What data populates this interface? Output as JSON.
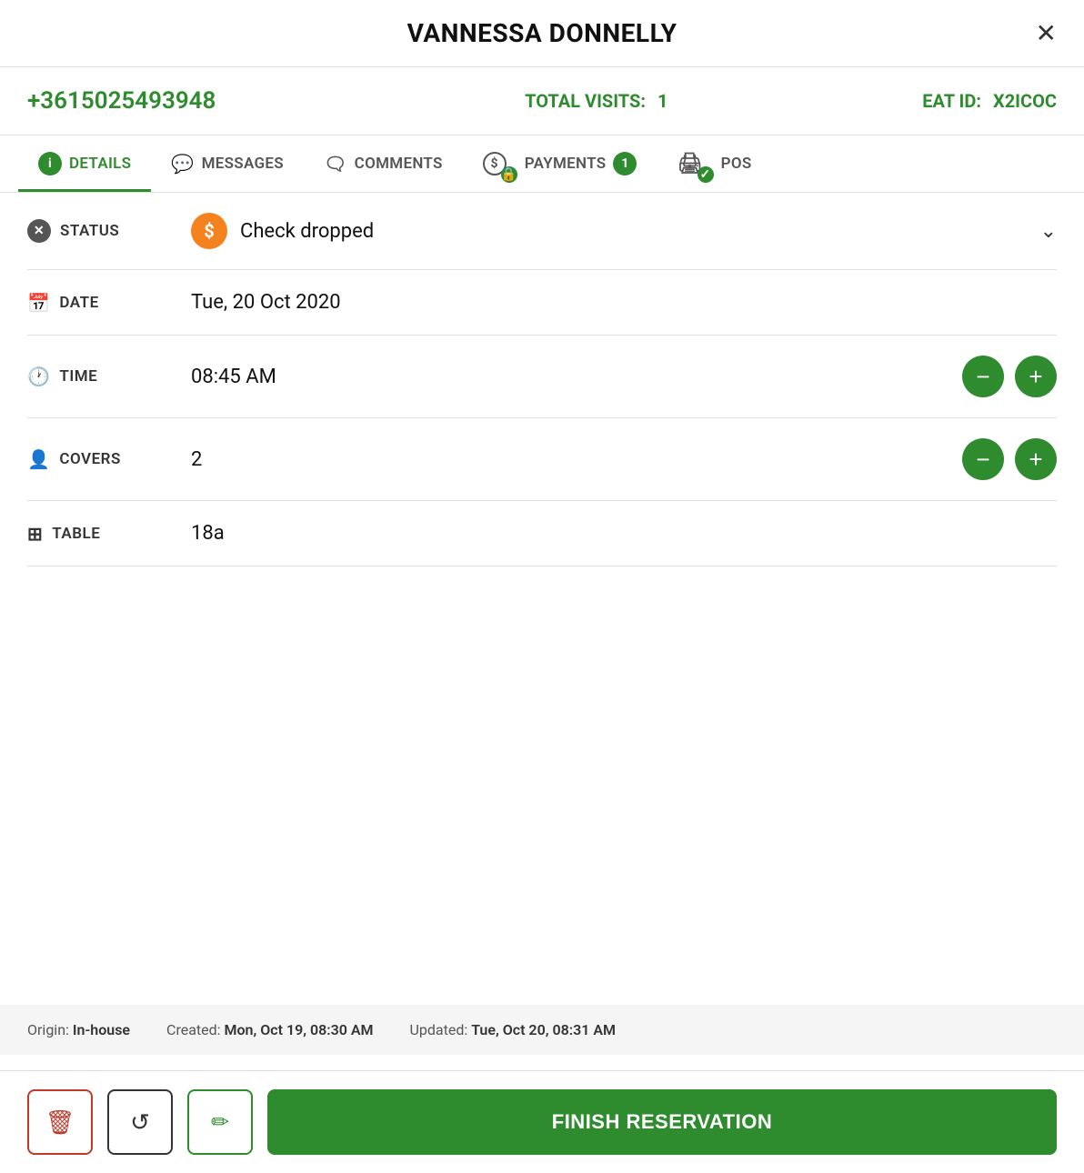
{
  "header": {
    "title": "VANNESSA DONNELLY",
    "close_label": "✕"
  },
  "info": {
    "phone": "+3615025493948",
    "total_visits_label": "TOTAL VISITS:",
    "total_visits_value": "1",
    "eat_id_label": "EAT ID:",
    "eat_id_value": "X2ICOC"
  },
  "tabs": [
    {
      "id": "details",
      "label": "DETAILS",
      "icon": "ℹ",
      "active": true,
      "badge": null
    },
    {
      "id": "messages",
      "label": "MESSAGES",
      "icon": "💬",
      "active": false,
      "badge": null
    },
    {
      "id": "comments",
      "label": "COMMENTS",
      "icon": "🗨",
      "active": false,
      "badge": null
    },
    {
      "id": "payments",
      "label": "PAYMENTS",
      "icon": "$",
      "active": false,
      "badge": "1"
    },
    {
      "id": "pos",
      "label": "POS",
      "icon": "🖨",
      "active": false,
      "badge": null
    }
  ],
  "details": {
    "status_label": "STATUS",
    "status_value": "Check dropped",
    "date_label": "DATE",
    "date_value": "Tue, 20 Oct 2020",
    "time_label": "TIME",
    "time_value": "08:45 AM",
    "covers_label": "COVERS",
    "covers_value": "2",
    "table_label": "TABLE",
    "table_value": "18a"
  },
  "footer": {
    "origin_label": "Origin:",
    "origin_value": "In-house",
    "created_label": "Created:",
    "created_value": "Mon, Oct 19, 08:30 AM",
    "updated_label": "Updated:",
    "updated_value": "Tue, Oct 20, 08:31 AM"
  },
  "actions": {
    "finish_label": "FINISH RESERVATION",
    "delete_icon": "🗑",
    "history_icon": "⟳",
    "edit_icon": "✏"
  },
  "colors": {
    "green": "#2e8b2e",
    "red": "#c0392b",
    "orange": "#f5821f"
  }
}
